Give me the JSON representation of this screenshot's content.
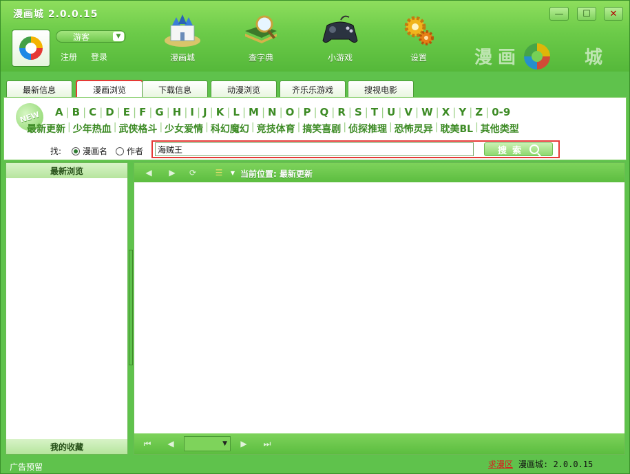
{
  "window": {
    "title": "漫画城 2.0.0.15",
    "minimize_icon": "minimize-icon",
    "maximize_icon": "maximize-icon",
    "close_icon": "close-icon"
  },
  "user": {
    "status": "游客",
    "register": "注册",
    "login": "登录"
  },
  "nav": [
    {
      "label": "漫画城",
      "icon": "castle-icon"
    },
    {
      "label": "查字典",
      "icon": "dictionary-icon"
    },
    {
      "label": "小游戏",
      "icon": "gamepad-icon"
    },
    {
      "label": "设置",
      "icon": "gears-icon"
    }
  ],
  "brand": {
    "text1": "漫画",
    "text2": "城"
  },
  "tabs": [
    "最新信息",
    "漫画浏览",
    "下载信息",
    "动漫浏览",
    "齐乐乐游戏",
    "搜视电影"
  ],
  "active_tab": "漫画浏览",
  "filter": {
    "new_badge": "NEW",
    "letters": [
      "A",
      "B",
      "C",
      "D",
      "E",
      "F",
      "G",
      "H",
      "I",
      "J",
      "K",
      "L",
      "M",
      "N",
      "O",
      "P",
      "Q",
      "R",
      "S",
      "T",
      "U",
      "V",
      "W",
      "X",
      "Y",
      "Z",
      "0-9"
    ],
    "genres": [
      "最新更新",
      "少年热血",
      "武侠格斗",
      "少女爱情",
      "科幻魔幻",
      "竞技体育",
      "搞笑喜剧",
      "侦探推理",
      "恐怖灵异",
      "耽美BL",
      "其他类型"
    ]
  },
  "search": {
    "find_label": "找:",
    "option_name": "漫画名",
    "option_author": "作者",
    "selected": "漫画名",
    "value": "海贼王",
    "button": "搜索"
  },
  "left_panel": {
    "header_top": "最新浏览",
    "header_bottom": "我的收藏"
  },
  "main": {
    "location_label": "当前位置:",
    "location_value": "最新更新"
  },
  "status": {
    "ad": "广告预留",
    "hot_link": "求漫区",
    "version": "漫画城: 2.0.0.15"
  },
  "colors": {
    "accent_green": "#5fc24c",
    "highlight_red": "#e53935",
    "text_green": "#3d8b25"
  }
}
